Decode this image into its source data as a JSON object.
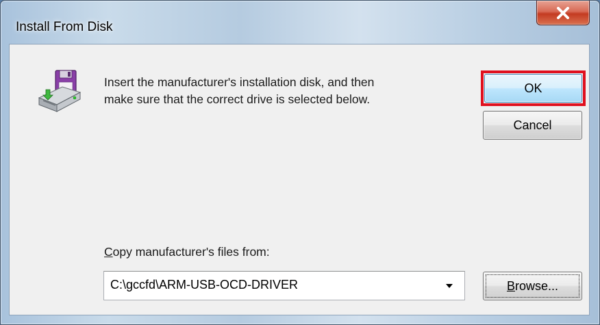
{
  "window": {
    "title": "Install From Disk",
    "close_icon": "close-icon"
  },
  "message": {
    "line1": "Insert the manufacturer's installation disk, and then",
    "line2": "make sure that the correct drive is selected below.",
    "icon": "floppy-disk-drive-icon"
  },
  "buttons": {
    "ok_label": "OK",
    "cancel_label": "Cancel",
    "browse_label_mnemonic": "B",
    "browse_label_rest": "rowse..."
  },
  "copy_from": {
    "label_mnemonic": "C",
    "label_rest": "opy manufacturer's files from:",
    "value": "C:\\gccfd\\ARM-USB-OCD-DRIVER",
    "dropdown_icon": "chevron-down-icon"
  },
  "colors": {
    "highlight_border": "#e0101e",
    "close_button": "#c43b22",
    "dialog_background": "#f0f0f0"
  }
}
